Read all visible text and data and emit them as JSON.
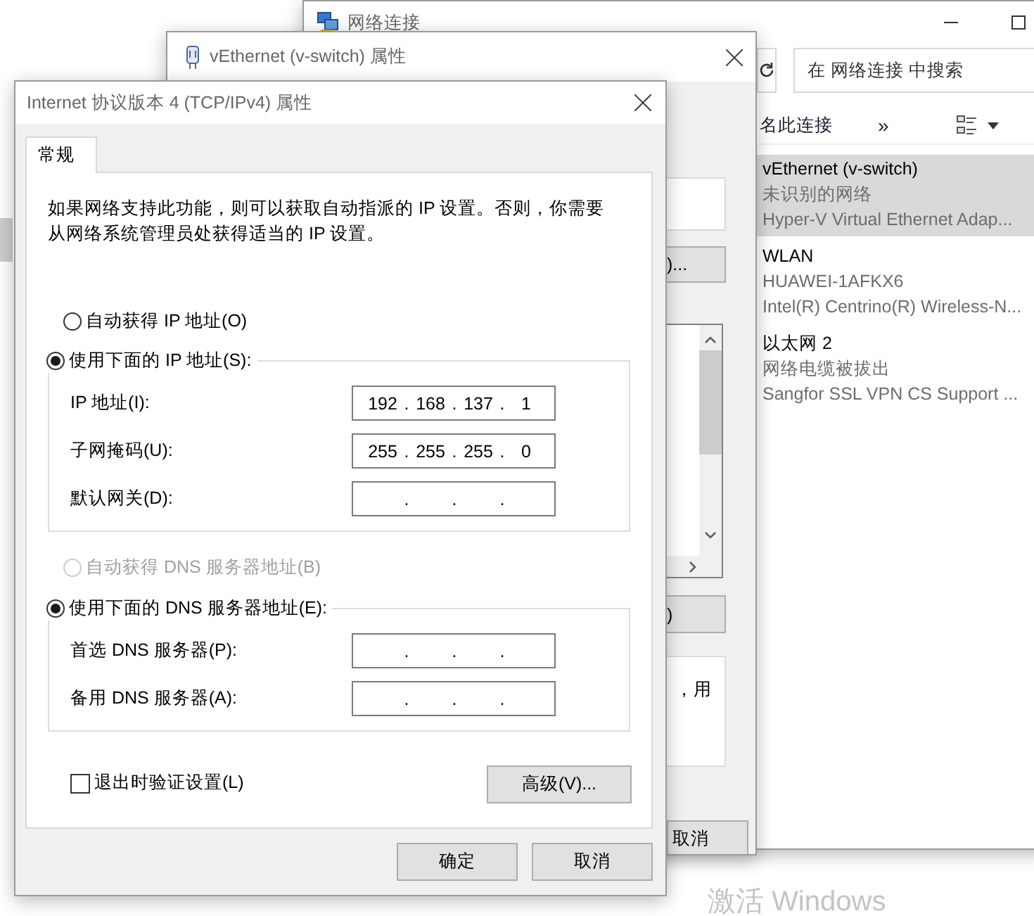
{
  "explorer": {
    "title": "网络连接",
    "search": {
      "placeholder": "在 网络连接 中搜索"
    },
    "toolbar": [
      {
        "label": "名此连接"
      },
      {
        "label": "»"
      }
    ],
    "connections": [
      {
        "name": "vEthernet (v-switch)",
        "status": "未识别的网络",
        "adapter": "Hyper-V Virtual Ethernet Adap...",
        "selected": true
      },
      {
        "name": "WLAN",
        "status": "HUAWEI-1AFKX6",
        "adapter": "Intel(R) Centrino(R) Wireless-N...",
        "selected": false
      },
      {
        "name": "以太网 2",
        "status": "网络电缆被拔出",
        "adapter": "Sangfor SSL VPN CS Support ...",
        "selected": false
      }
    ]
  },
  "adapter_properties": {
    "title": "vEthernet (v-switch) 属性",
    "configure_button": ")...",
    "properties_button": ")",
    "description": "，用",
    "buttons": [
      "取消"
    ]
  },
  "dialog": {
    "title": "Internet 协议版本 4 (TCP/IPv4) 属性",
    "tabs": [
      {
        "label": "常规",
        "selected": true
      }
    ],
    "description": "如果网络支持此功能，则可以获取自动指派的 IP 设置。否则，你需要从网络系统管理员处获得适当的 IP 设置。",
    "separator": ".",
    "ip_section": {
      "options": [
        {
          "label": "自动获得 IP 地址(O)",
          "selected": false,
          "disabled": false
        },
        {
          "label": "使用下面的 IP 地址(S):",
          "selected": true,
          "disabled": false
        }
      ],
      "fields": [
        {
          "label": "IP 地址(I):",
          "octets": [
            "192",
            "168",
            "137",
            "1"
          ]
        },
        {
          "label": "子网掩码(U):",
          "octets": [
            "255",
            "255",
            "255",
            "0"
          ]
        },
        {
          "label": "默认网关(D):"
        }
      ]
    },
    "dns_section": {
      "options": [
        {
          "label": "自动获得 DNS 服务器地址(B)",
          "selected": false,
          "disabled": true
        },
        {
          "label": "使用下面的 DNS 服务器地址(E):",
          "selected": true,
          "disabled": false
        }
      ],
      "fields": [
        {
          "label": "首选 DNS 服务器(P):"
        },
        {
          "label": "备用 DNS 服务器(A):"
        }
      ]
    },
    "validate_on_exit": {
      "label": "退出时验证设置(L)",
      "checked": false
    },
    "advanced_button": "高级(V)...",
    "buttons": [
      "确定",
      "取消"
    ]
  },
  "activation_notice": "激活 Windows"
}
